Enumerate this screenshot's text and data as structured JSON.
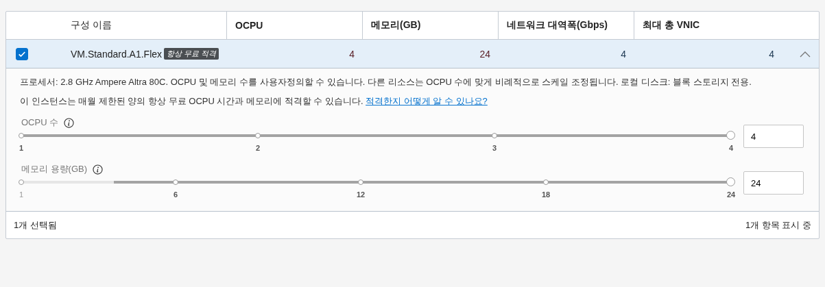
{
  "table": {
    "columns": [
      {
        "label": "구성 이름",
        "bold": false
      },
      {
        "label": "OCPU",
        "bold": true
      },
      {
        "label": "메모리(GB)",
        "bold": true
      },
      {
        "label": "네트워크 대역폭(Gbps)",
        "bold": true
      },
      {
        "label": "최대 총 VNIC",
        "bold": true
      }
    ],
    "rows": [
      {
        "checked": true,
        "expanded": true,
        "name": "VM.Standard.A1.Flex",
        "badge": "항상 무료 적격",
        "ocpu": "4",
        "memory": "24",
        "network": "4",
        "vnic": "4",
        "details": {
          "description": "프로세서: 2.8 GHz Ampere Altra 80C. OCPU 및 메모리 수를 사용자정의할 수 있습니다. 다른 리소스는 OCPU 수에 맞게 비례적으로 스케일 조정됩니다. 로컬 디스크: 블록 스토리지 전용.",
          "eligibility": "이 인스턴스는 매월 제한된 양의 항상 무료 OCPU 시간과 메모리에 적격할 수 있습니다.",
          "link": "적격한지 어떻게 알 수 있나요?",
          "sliders": [
            {
              "label": "OCPU 수",
              "level": 1,
              "value": "4",
              "ticks": [
                {
                  "label": "1",
                  "disabled": false
                },
                {
                  "label": "2",
                  "disabled": false
                },
                {
                  "label": "3",
                  "disabled": false
                },
                {
                  "label": "4",
                  "disabled": false
                }
              ]
            },
            {
              "label": "메모리 용량(GB)",
              "level": 1,
              "value": "24",
              "ticks": [
                {
                  "label": "1",
                  "disabled": true
                },
                {
                  "label": "6",
                  "disabled": false
                },
                {
                  "label": "12",
                  "disabled": false
                },
                {
                  "label": "18",
                  "disabled": false
                },
                {
                  "label": "24",
                  "disabled": false
                }
              ]
            }
          ]
        }
      }
    ]
  },
  "footer": {
    "selected": "1개 선택됨",
    "showing": "1개 항목 표시 중"
  }
}
